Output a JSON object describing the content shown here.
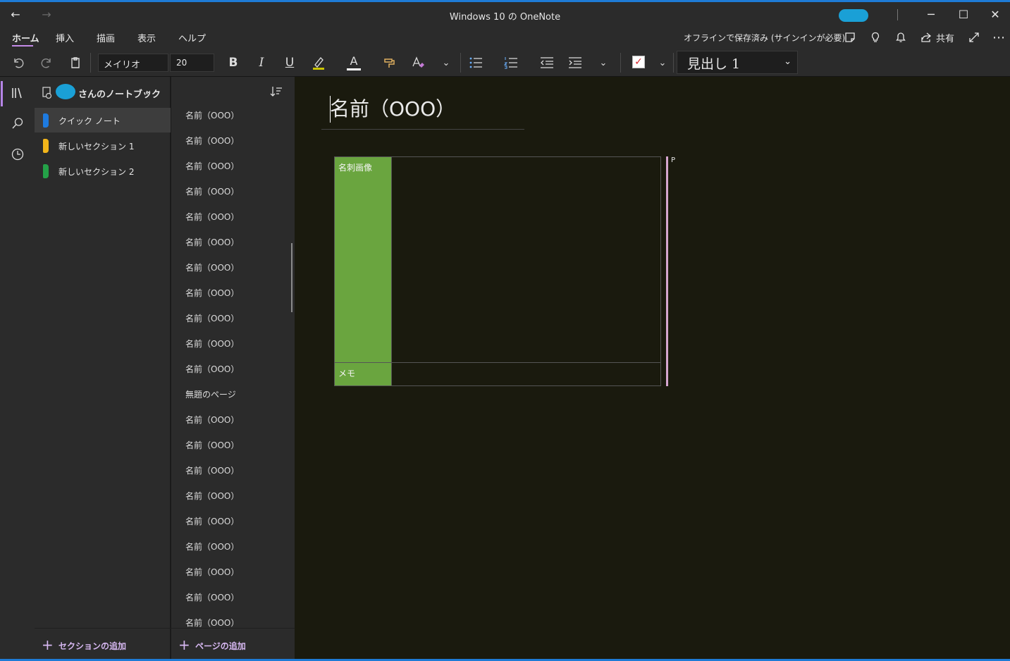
{
  "window": {
    "title": "Windows 10 の OneNote",
    "back_glyph": "←",
    "forward_glyph": "→",
    "minimize_glyph": "─",
    "maximize_glyph": "☐",
    "close_glyph": "✕"
  },
  "ribbon": {
    "tabs": [
      {
        "label": "ホーム",
        "active": true
      },
      {
        "label": "挿入",
        "active": false
      },
      {
        "label": "描画",
        "active": false
      },
      {
        "label": "表示",
        "active": false
      },
      {
        "label": "ヘルプ",
        "active": false
      }
    ],
    "status": "オフラインで保存済み (サインインが必要)",
    "share_label": "共有"
  },
  "toolbar": {
    "font_name": "メイリオ",
    "font_size": "20",
    "bold": "B",
    "italic": "I",
    "underline": "U",
    "font_color_letter": "A",
    "style": "見出し 1",
    "chevron": "⌄"
  },
  "notebook": {
    "name": "さんのノートブック",
    "sections": [
      {
        "label": "クイック ノート",
        "color": "#1e7be0",
        "selected": true
      },
      {
        "label": "新しいセクション 1",
        "color": "#f2b51a",
        "selected": false
      },
      {
        "label": "新しいセクション 2",
        "color": "#24a148",
        "selected": false
      }
    ],
    "add_section_label": "セクションの追加"
  },
  "pages": {
    "items": [
      "名前（OOO）",
      "名前（OOO）",
      "名前（OOO）",
      "名前（OOO）",
      "名前（OOO）",
      "名前（OOO）",
      "名前（OOO）",
      "名前（OOO）",
      "名前（OOO）",
      "名前（OOO）",
      "名前（OOO）",
      "無題のページ",
      "名前（OOO）",
      "名前（OOO）",
      "名前（OOO）",
      "名前（OOO）",
      "名前（OOO）",
      "名前（OOO）",
      "名前（OOO）",
      "名前（OOO）",
      "名前（OOO）"
    ],
    "add_page_label": "ページの追加"
  },
  "note": {
    "title": "名前（OOO）",
    "table": {
      "row1_label": "名刺画像",
      "row2_label": "メモ"
    },
    "side_marker": "P"
  },
  "colors": {
    "accent": "#c48be8",
    "titlebar_line": "#1e7bd6",
    "table_label_bg": "#6aa53f"
  }
}
